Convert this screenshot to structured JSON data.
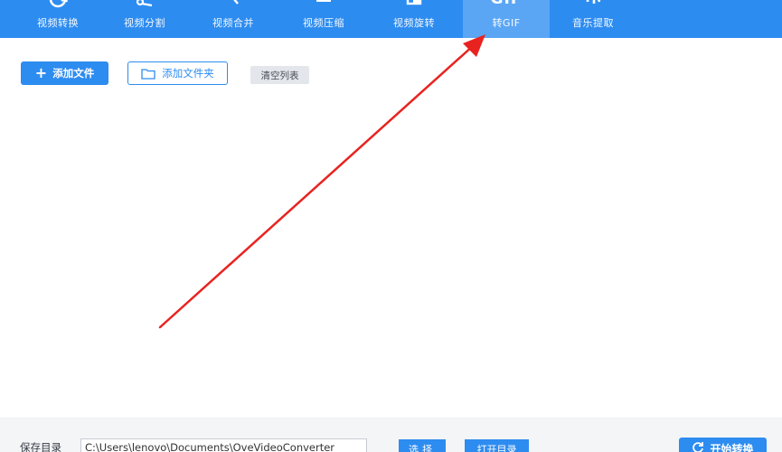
{
  "toolbar": {
    "tabs": [
      {
        "label": "视频转换",
        "icon": "convert-icon"
      },
      {
        "label": "视频分割",
        "icon": "scissors-icon"
      },
      {
        "label": "视频合并",
        "icon": "merge-icon"
      },
      {
        "label": "视频压缩",
        "icon": "compress-icon"
      },
      {
        "label": "视频旋转",
        "icon": "rotate-icon"
      },
      {
        "label": "转GIF",
        "icon": "gif-icon",
        "icon_text": "GIF",
        "active": true
      },
      {
        "label": "音乐提取",
        "icon": "music-extract-icon"
      }
    ]
  },
  "actions": {
    "add_file": "添加文件",
    "add_folder": "添加文件夹",
    "clear_list": "清空列表"
  },
  "footer": {
    "save_label": "保存目录",
    "save_path": "C:\\Users\\lenovo\\Documents\\OveVideoConverter",
    "select_button": "选择",
    "open_dir_button": "打开目录",
    "start_button": "开始转换"
  },
  "colors": {
    "primary": "#2d8cf0",
    "active_tab": "#5aa6f5",
    "annotation_arrow": "#e8231f"
  }
}
